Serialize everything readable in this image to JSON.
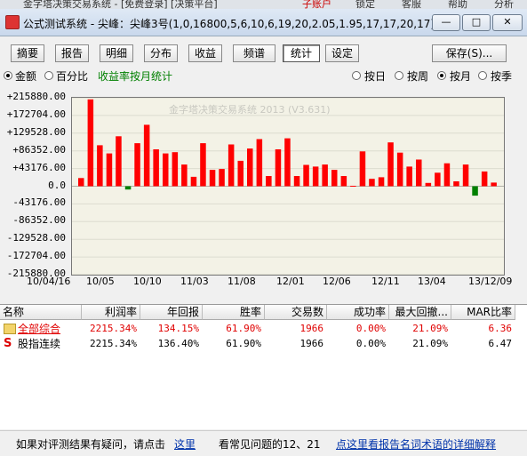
{
  "background_window": {
    "left_text": "金字塔决策交易系统 - [免费登录]   [决策平台]",
    "tabs": [
      "子账户",
      "锁定",
      "客服",
      "帮助",
      "分析"
    ]
  },
  "window": {
    "title": "公式测试系统 - 尖峰：尖峰3号(1,0,16800,5,6,10,6,19,20,2.05,1.95,17,17,20,17)(5分)",
    "btn_min": "—",
    "btn_max": "□",
    "btn_close": "✕"
  },
  "toolbar": {
    "tabs": [
      "摘要",
      "报告",
      "明细",
      "分布",
      "收益",
      "频谱",
      "统计",
      "设定"
    ],
    "active": "统计",
    "save_label": "保存(S)..."
  },
  "options": {
    "amount_label": "金额",
    "percent_label": "百分比",
    "stat_title": "收益率按月统计",
    "by_day": "按日",
    "by_week": "按周",
    "by_month": "按月",
    "by_season": "按季",
    "mode_selected": "金额",
    "period_selected": "按月"
  },
  "chart_data": {
    "type": "bar",
    "watermark": "金字塔决策交易系统 2013 (V3.631)",
    "ylim": [
      -215880,
      215880
    ],
    "y_ticks": [
      "+215880.00",
      "+172704.00",
      "+129528.00",
      "+86352.00",
      "+43176.00",
      "0.0",
      "-43176.00",
      "-86352.00",
      "-129528.00",
      "-172704.00",
      "-215880.00"
    ],
    "x_ticks": [
      "10/04/16",
      "10/05",
      "10/10",
      "11/03",
      "11/08",
      "12/01",
      "12/06",
      "12/11",
      "13/04",
      "13/12/09"
    ],
    "colors": {
      "positive": "#ff0000",
      "negative": "#008000",
      "background": "#f3f2e6"
    },
    "values": [
      20000,
      212000,
      100000,
      80000,
      122000,
      -8000,
      105000,
      150000,
      90000,
      80000,
      83000,
      53000,
      23000,
      105000,
      40000,
      42000,
      102000,
      62000,
      92000,
      115000,
      25000,
      90000,
      117000,
      25000,
      52000,
      48000,
      53000,
      40000,
      25000,
      1000,
      85000,
      18000,
      22000,
      107000,
      82000,
      48000,
      65000,
      8000,
      33000,
      56000,
      12000,
      53000,
      -23000,
      36000,
      9000
    ]
  },
  "table": {
    "headers": [
      "名称",
      "利润率",
      "年回报",
      "胜率",
      "交易数",
      "成功率",
      "最大回撤...",
      "MAR比率"
    ],
    "rows": [
      {
        "icon": "folder",
        "name": "全部综合",
        "values": [
          "2215.34%",
          "134.15%",
          "61.90%",
          "1966",
          "0.00%",
          "21.09%",
          "6.36"
        ],
        "color": "#e00000"
      },
      {
        "icon": "S",
        "name": "股指连续",
        "values": [
          "2215.34%",
          "136.40%",
          "61.90%",
          "1966",
          "0.00%",
          "21.09%",
          "6.47"
        ],
        "color": "#000000"
      }
    ]
  },
  "footer": {
    "question": "如果对评测结果有疑问，请点击",
    "here_link": "这里",
    "faq": "看常见问题的12、21",
    "glossary_link": "点这里看报告名词术语的详细解释"
  }
}
